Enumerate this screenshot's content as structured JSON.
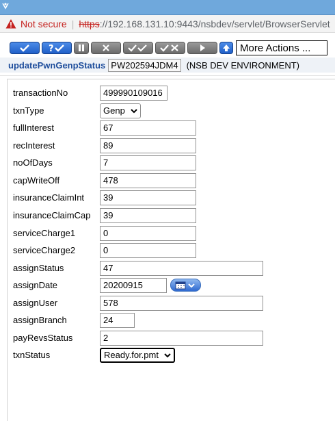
{
  "browser": {
    "not_secure": "Not secure",
    "url_scheme": "https",
    "url_rest": "://192.168.131.10:9443/nsbdev/servlet/BrowserServlet"
  },
  "toolbar": {
    "more_actions": "More Actions ..."
  },
  "header": {
    "txn_name": "updatePwnGenpStatus",
    "txn_id": "PW202594JDM4",
    "env": "(NSB DEV ENVIRONMENT)"
  },
  "form": {
    "transactionNo": {
      "label": "transactionNo",
      "value": "499990109016"
    },
    "txnType": {
      "label": "txnType",
      "value": "Genp"
    },
    "fullInterest": {
      "label": "fullInterest",
      "value": "67"
    },
    "recInterest": {
      "label": "recInterest",
      "value": "89"
    },
    "noOfDays": {
      "label": "noOfDays",
      "value": "7"
    },
    "capWriteOff": {
      "label": "capWriteOff",
      "value": "478"
    },
    "insuranceClaimInt": {
      "label": "insuranceClaimInt",
      "value": "39"
    },
    "insuranceClaimCap": {
      "label": "insuranceClaimCap",
      "value": "39"
    },
    "serviceCharge1": {
      "label": "serviceCharge1",
      "value": "0"
    },
    "serviceCharge2": {
      "label": "serviceCharge2",
      "value": "0"
    },
    "assignStatus": {
      "label": "assignStatus",
      "value": "47"
    },
    "assignDate": {
      "label": "assignDate",
      "value": "20200915"
    },
    "assignUser": {
      "label": "assignUser",
      "value": "578"
    },
    "assignBranch": {
      "label": "assignBranch",
      "value": "24"
    },
    "payRevsStatus": {
      "label": "payRevsStatus",
      "value": "2"
    },
    "txnStatus": {
      "label": "txnStatus",
      "value": "Ready.for.pmt"
    }
  },
  "colors": {
    "accent_blue": "#1f5fc8",
    "title_blue": "#1f4e9c",
    "warning_red": "#c5221f"
  }
}
